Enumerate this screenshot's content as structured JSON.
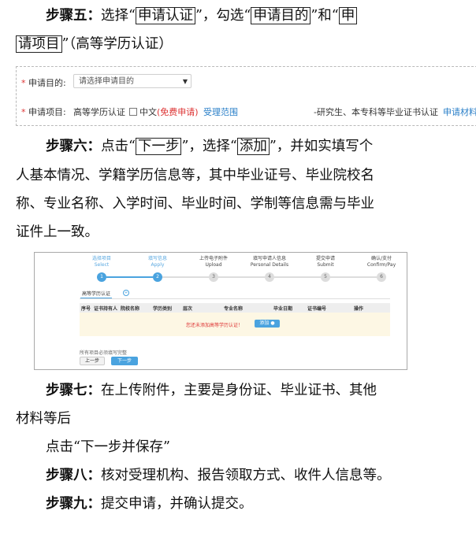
{
  "step5": {
    "label": "步骤五：",
    "t1": "选择“",
    "box1": "申请认证",
    "t2": "”，勾选“",
    "box2": "申请目的",
    "t3": "”和“",
    "box3a": "申",
    "box3b": "请项目",
    "t4": "”（高等学历认证）"
  },
  "screenshot1": {
    "purpose_label": "申请目的:",
    "purpose_placeholder": "请选择申请目的",
    "items_label": "申请项目:",
    "item_name": "高等学历认证",
    "checkbox_label": "中文",
    "free_text": "(免费申请)",
    "scope_link": "受理范围",
    "note": "-研究生、本专科等毕业证书认证",
    "materials_link": "申请材料"
  },
  "step6": {
    "label": "步骤六：",
    "t1": "点击“",
    "box1": "下一步",
    "t2": "”，选择“",
    "box2": "添加",
    "t3": "”，并如实填写个",
    "line2": "人基本情况、学籍学历信息等，其中毕业证号、毕业院校名",
    "line3": "称、专业名称、入学时间、毕业时间、学制等信息需与毕业",
    "line4": "证件上一致。"
  },
  "screenshot2": {
    "steps": [
      {
        "cn": "选择项目",
        "en": "Select",
        "num": "1"
      },
      {
        "cn": "填写信息",
        "en": "Apply",
        "num": "2"
      },
      {
        "cn": "上传电子附件",
        "en": "Upload",
        "num": "3"
      },
      {
        "cn": "填写申请人信息",
        "en": "Personal Details",
        "num": "4"
      },
      {
        "cn": "提交申请",
        "en": "Submit",
        "num": "5"
      },
      {
        "cn": "确认/支付",
        "en": "Confirm/Pay",
        "num": "6"
      }
    ],
    "tab_label": "高等学历认证",
    "tab_icon": "plus-circle-icon",
    "columns": [
      "序号",
      "证书持有人",
      "院校名称",
      "学历类别",
      "层次",
      "专业名称",
      "毕业日期",
      "证书编号",
      "操作"
    ],
    "empty_text": "您还未添加高等学历认证！",
    "add_button": "添加",
    "note": "所有项目必须填写完整",
    "prev_button": "上一步",
    "next_button": "下一步",
    "accent": "#4aa3df"
  },
  "step7": {
    "label": "步骤七：",
    "t1": "在上传附件，主要是身份证、毕业证书、其他",
    "line2": "材料等后",
    "line3": "点击“下一步并保存”"
  },
  "step8": {
    "label": "步骤八：",
    "text": "核对受理机构、报告领取方式、收件人信息等。"
  },
  "step9": {
    "label": "步骤九：",
    "text": "提交申请，并确认提交。"
  }
}
